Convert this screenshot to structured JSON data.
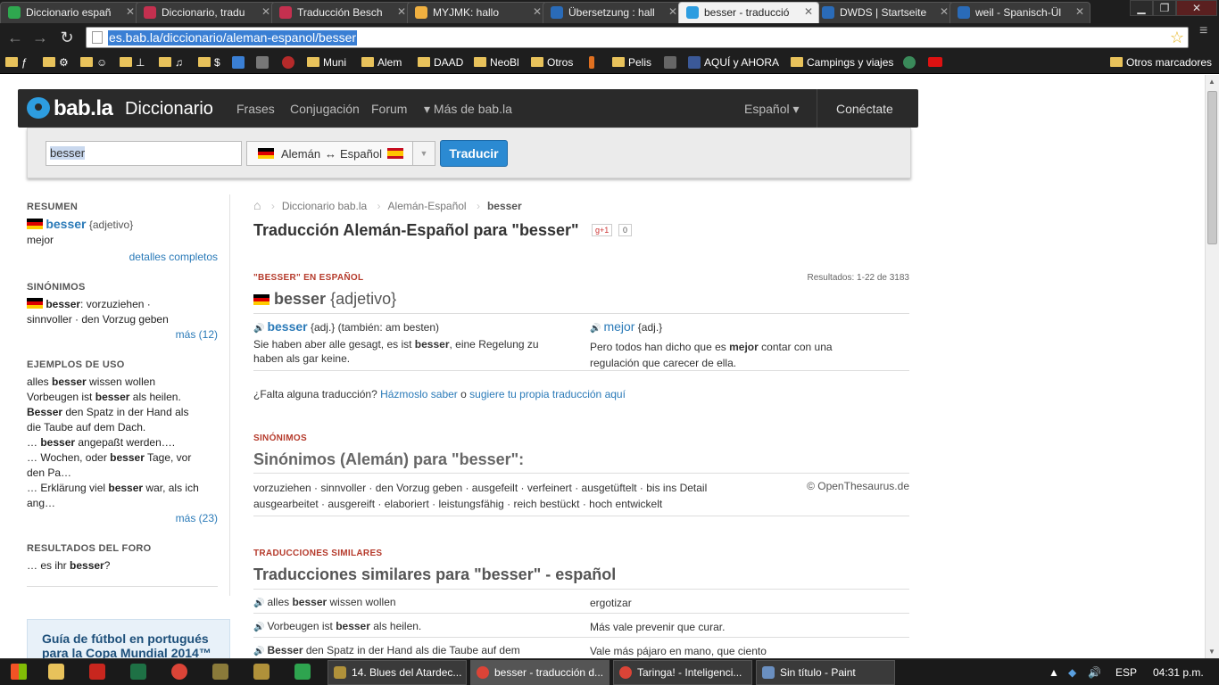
{
  "browser": {
    "tabs": [
      {
        "title": "Diccionario españ",
        "color": "#2fa84f"
      },
      {
        "title": "Diccionario, tradu",
        "color": "#c4304f"
      },
      {
        "title": "Traducción Besch",
        "color": "#c4304f"
      },
      {
        "title": "MYJMK: hallo",
        "color": "#f0b040"
      },
      {
        "title": "Übersetzung : hall",
        "color": "#2a6bb8"
      },
      {
        "title": "besser - traducció",
        "color": "#2d9de0"
      },
      {
        "title": "DWDS | Startseite",
        "color": "#2a6bb8"
      },
      {
        "title": "weil - Spanisch-Ül",
        "color": "#2a6bb8"
      }
    ],
    "url": "es.bab.la/diccionario/aleman-espanol/besser",
    "bookmarks": [
      {
        "label": "ƒ"
      },
      {
        "label": "⚙"
      },
      {
        "label": "☺"
      },
      {
        "label": "⊥"
      },
      {
        "label": "♫"
      },
      {
        "label": "$"
      },
      {
        "label": "Muni"
      },
      {
        "label": "Alem"
      },
      {
        "label": "DAAD"
      },
      {
        "label": "NeoBl"
      },
      {
        "label": "Otros"
      },
      {
        "label": "Pelis"
      },
      {
        "label": "AQUÍ y AHORA"
      },
      {
        "label": "Campings y viajes"
      }
    ],
    "other_bookmarks": "Otros marcadores"
  },
  "header": {
    "logo": "bab.la",
    "section": "Diccionario",
    "nav": [
      "Frases",
      "Conjugación",
      "Forum",
      "▾ Más de bab.la"
    ],
    "language": "Español ▾",
    "login": "Conéctate"
  },
  "search": {
    "value": "besser",
    "lang_from": "Alemán",
    "arrow": "↔",
    "lang_to": "Español",
    "button": "Traducir"
  },
  "sidebar": {
    "resumen": {
      "heading": "RESUMEN",
      "word": "besser",
      "pos": "{adjetivo}",
      "meaning": "mejor",
      "details": "detalles completos"
    },
    "sinonimos": {
      "heading": "SINÓNIMOS",
      "word": "besser",
      "rest1": ": vorzuziehen ·",
      "rest2": "sinnvoller · den Vorzug geben",
      "more": "más (12)"
    },
    "ejemplos": {
      "heading": "EJEMPLOS DE USO",
      "lines": [
        [
          "alles ",
          "besser",
          " wissen wollen"
        ],
        [
          "Vorbeugen ist ",
          "besser",
          " als heilen."
        ],
        [
          "",
          "Besser",
          " den Spatz in der Hand als"
        ],
        [
          "die Taube auf dem Dach.",
          "",
          ""
        ],
        [
          "… ",
          "besser",
          " angepaßt werden…."
        ],
        [
          "… Wochen, oder ",
          "besser",
          " Tage, vor"
        ],
        [
          "den Pa…",
          "",
          ""
        ],
        [
          "… Erklärung viel ",
          "besser",
          " war, als ich"
        ],
        [
          "ang…",
          "",
          ""
        ]
      ],
      "more": "más (23)"
    },
    "foro": {
      "heading": "RESULTADOS DEL FORO",
      "line": [
        "… es ihr ",
        "besser",
        "?"
      ]
    },
    "guia": {
      "line1": "Guía de fútbol en portugués",
      "line2": "para la Copa Mundial 2014™"
    }
  },
  "main": {
    "breadcrumb": [
      "Diccionario bab.la",
      "Alemán-Español",
      "besser"
    ],
    "title": "Traducción Alemán-Español para \"besser\"",
    "gplus": "g+1",
    "gcount": "0",
    "sec1": "\"BESSER\" EN ESPAÑOL",
    "results": "Resultados: 1-22 de 3183",
    "entry": {
      "word": "besser",
      "pos": "{adjetivo}"
    },
    "trans_left": {
      "word": "besser",
      "meta": " {adj.} (también: am besten)",
      "ex1": "Sie haben aber alle gesagt, es ist ",
      "exb": "besser",
      "ex2": ", eine Regelung zu",
      "ex3": "haben als gar keine."
    },
    "trans_right": {
      "word": "mejor",
      "meta": " {adj.}",
      "ex1": "Pero todos han dicho que es ",
      "exb": "mejor",
      "ex2": " contar con una",
      "ex3": "regulación que carecer de ella."
    },
    "missing": {
      "q": "¿Falta alguna traducción? ",
      "l1": "Házmoslo saber",
      "o": " o ",
      "l2": "sugiere tu propia traducción aquí"
    },
    "sec2": "SINÓNIMOS",
    "syn_title": "Sinónimos (Alemán) para \"besser\":",
    "syn_line1": "vorzuziehen · sinnvoller · den Vorzug geben · ausgefeilt · verfeinert · ausgetüftelt · bis ins Detail",
    "syn_line2": "ausgearbeitet · ausgereift · elaboriert · leistungsfähig · reich bestückt · hoch entwickelt",
    "syn_credit": "© OpenThesaurus.de",
    "sec3": "TRADUCCIONES SIMILARES",
    "sim_title": "Traducciones similares para \"besser\" - español",
    "similar": [
      {
        "a": "alles ",
        "b": "besser",
        "c": " wissen wollen",
        "es": "ergotizar"
      },
      {
        "a": "Vorbeugen ist ",
        "b": "besser",
        "c": " als heilen.",
        "es": "Más vale prevenir que curar."
      },
      {
        "a": "",
        "b": "Besser",
        "c": " den Spatz in der Hand als die Taube auf dem",
        "es": "Vale más pájaro en mano, que ciento"
      }
    ]
  },
  "taskbar": {
    "tasks": [
      "14. Blues del Atardec...",
      "besser - traducción d...",
      "Taringa! - Inteligenci...",
      "Sin título - Paint"
    ],
    "lang": "ESP",
    "time": "04:31 p.m."
  }
}
